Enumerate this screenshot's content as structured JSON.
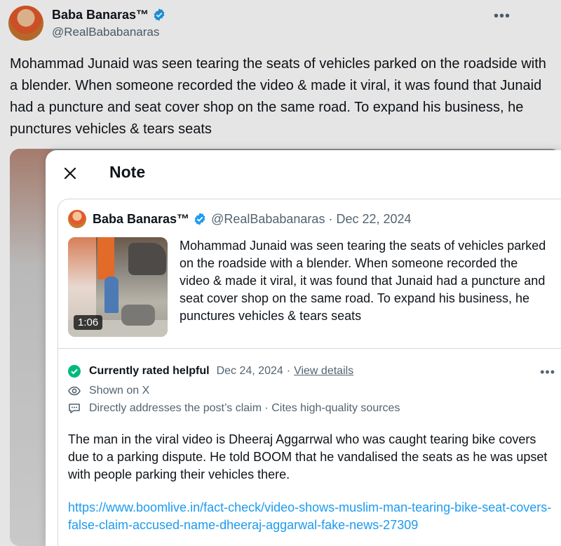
{
  "background_tweet": {
    "author_name": "Baba Banaras™",
    "author_handle": "@RealBababanaras",
    "more_label": "•••",
    "text": "Mohammad Junaid was seen tearing the seats of vehicles parked on the roadside with a blender. When someone recorded the video & made it viral, it was found that Junaid had a puncture and seat cover shop on the same road. To expand his business, he punctures vehicles & tears seats"
  },
  "note": {
    "close_label": "✕",
    "title": "Note",
    "quoted_tweet": {
      "author_name": "Baba Banaras™",
      "author_handle": "@RealBababanaras",
      "separator": "·",
      "date": "Dec 22, 2024",
      "video_duration": "1:06",
      "text": "Mohammad Junaid was seen tearing the seats of vehicles parked on the roadside with a blender. When someone recorded the video & made it viral, it was found that Junaid had a puncture and seat cover shop on the same road. To expand his business, he punctures vehicles & tears seats"
    },
    "status": {
      "label": "Currently rated helpful",
      "date": "Dec 24, 2024",
      "separator": "·",
      "view_details": "View details",
      "more_label": "•••"
    },
    "shown_on": "Shown on X",
    "attributes": "Directly addresses the post’s claim · Cites high-quality sources",
    "body": "The man in the viral video is Dheeraj Aggarrwal who was caught tearing bike covers due to a parking dispute. He told BOOM that he vandalised the seats as he was upset with people parking their vehicles there.",
    "link": "https://www.boomlive.in/fact-check/video-shows-muslim-man-tearing-bike-seat-covers-false-claim-accused-name-dheeraj-aggarwal-fake-news-27309"
  },
  "colors": {
    "verified_blue": "#1d9bf0",
    "helpful_green": "#00ba7c",
    "link_blue": "#1d9bf0",
    "muted_text": "#536471"
  }
}
